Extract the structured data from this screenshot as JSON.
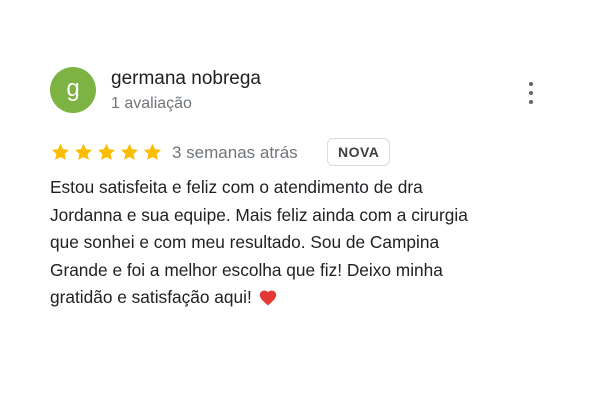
{
  "review": {
    "avatar_letter": "g",
    "avatar_color": "#7cb342",
    "author_name": "germana nobrega",
    "review_count": "1 avaliação",
    "rating": 5,
    "max_rating": 5,
    "star_color": "#fbbc04",
    "relative_time": "3 semanas atrás",
    "badge": "NOVA",
    "text_lines": [
      "Estou satisfeita e feliz com o atendimento de dra",
      "Jordanna e sua equipe. Mais feliz ainda com a cirurgia",
      "que sonhei e com meu resultado. Sou de Campina",
      "Grande e foi a melhor escolha que fiz! Deixo minha",
      "gratidão e satisfação aqui!"
    ],
    "trailing_emoji": "heart-icon",
    "heart_color": "#e53935"
  }
}
